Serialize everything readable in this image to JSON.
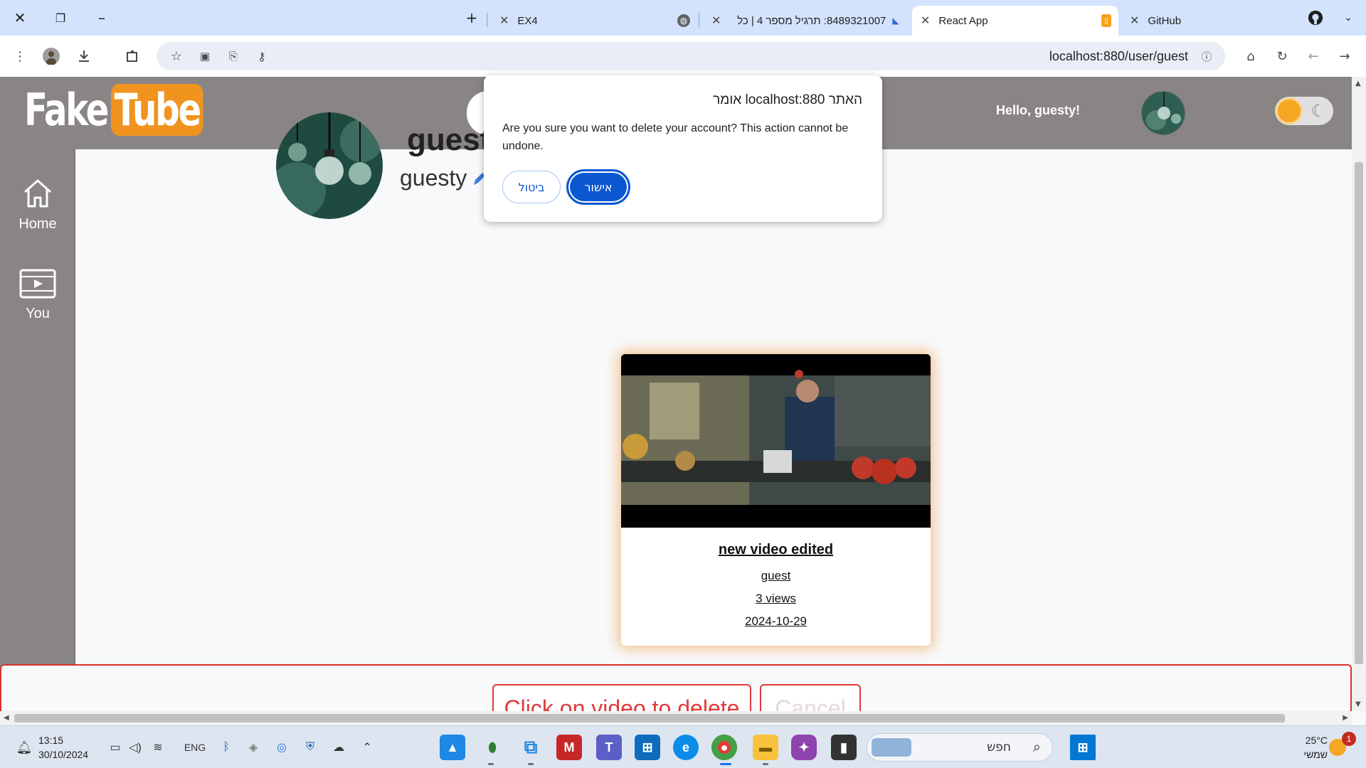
{
  "browser": {
    "tabs": [
      {
        "label": "EX4",
        "active": false
      },
      {
        "label": "8489321007: תרגיל מספר 4 | כל",
        "active": false
      },
      {
        "label": "React App",
        "active": true
      },
      {
        "label": "GitHub",
        "active": false
      }
    ],
    "url": "localhost:880/user/guest"
  },
  "app": {
    "logo": {
      "fake": "Fake",
      "tube": "Tube"
    },
    "greeting": "Hello, guesty!",
    "sidebar": [
      {
        "label": "Home",
        "icon": "home-icon"
      },
      {
        "label": "You",
        "icon": "video-library-icon"
      }
    ],
    "profile": {
      "name": "guest",
      "display_name": "guesty"
    },
    "video": {
      "title": "new video edited",
      "author": "guest",
      "views": "3 views",
      "date": "2024-10-29"
    },
    "delete_panel": {
      "delete_label": "Click on video to delete",
      "cancel_label": "Cancel"
    }
  },
  "dialog": {
    "title": "האתר localhost:880 אומר",
    "message": "Are you sure you want to delete your account? This action cannot be undone.",
    "ok_label": "אישור",
    "cancel_label": "ביטול"
  },
  "taskbar": {
    "time": "13:15",
    "date": "30/10/2024",
    "language": "ENG",
    "search_placeholder": "חפש",
    "temperature": "25°C",
    "weather_text": "שמשי",
    "notification_count": "1"
  },
  "colors": {
    "header_bg": "#8a8585",
    "accent_orange": "#f0931f",
    "dialog_primary": "#0b57d0",
    "delete_red": "#e03a3a"
  }
}
